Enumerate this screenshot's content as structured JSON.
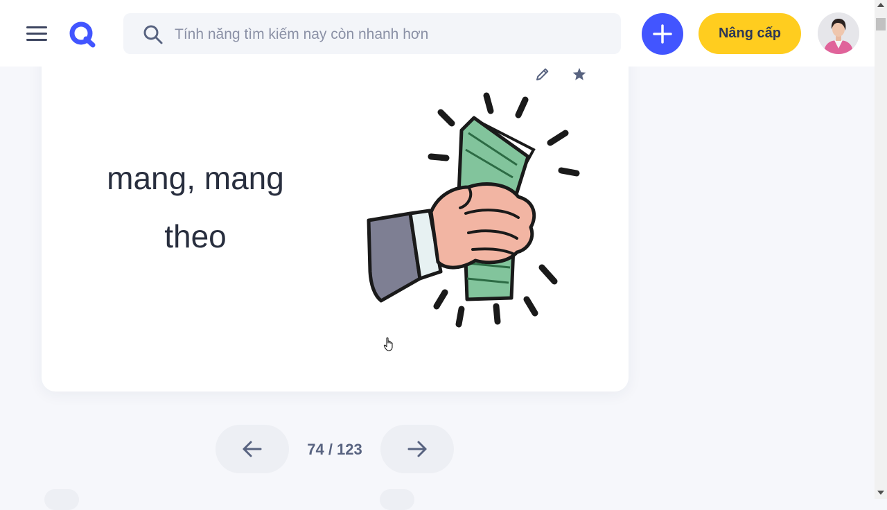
{
  "header": {
    "search": {
      "placeholder": "Tính năng tìm kiếm nay còn nhanh hơn"
    },
    "upgrade_label": "Nâng cấp",
    "icons": [
      "menu-icon",
      "quizlet-logo-icon",
      "search-icon",
      "plus-icon",
      "profile-avatar"
    ]
  },
  "flashcard": {
    "term_line1": "mang, mang",
    "term_line2": "theo",
    "image": "hand-holding-money-illustration",
    "icons": [
      "pencil-icon",
      "star-icon"
    ]
  },
  "navigation": {
    "counter": "74 / 123",
    "current": 74,
    "total": 123,
    "icons": [
      "arrow-left-icon",
      "arrow-right-icon"
    ]
  },
  "colors": {
    "brand_blue": "#4255ff",
    "upgrade_yellow": "#ffcd1f",
    "text_dark": "#282e3e",
    "background": "#f6f7fb"
  }
}
